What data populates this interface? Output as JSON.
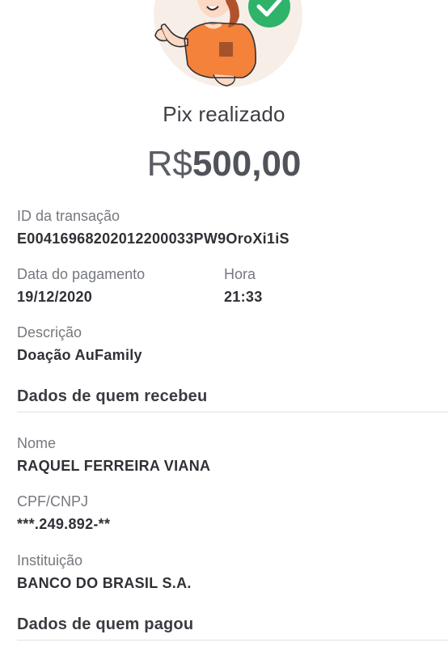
{
  "receipt": {
    "title": "Pix realizado",
    "currency": "R$",
    "amount": "500,00"
  },
  "transaction": {
    "id_label": "ID da transação",
    "id_value": "E00416968202012200033PW9OroXi1iS",
    "date_label": "Data do pagamento",
    "date_value": "19/12/2020",
    "time_label": "Hora",
    "time_value": "21:33",
    "description_label": "Descrição",
    "description_value": "Doação AuFamily"
  },
  "recipient": {
    "section_title": "Dados de quem recebeu",
    "name_label": "Nome",
    "name_value": "RAQUEL FERREIRA VIANA",
    "doc_label": "CPF/CNPJ",
    "doc_value": "***.249.892-**",
    "institution_label": "Instituição",
    "institution_value": "BANCO DO BRASIL S.A."
  },
  "payer": {
    "section_title": "Dados de quem pagou"
  },
  "colors": {
    "shirt": "#f4823a",
    "success": "#2fb36a",
    "background_circle": "#f8ede6"
  },
  "icons": {
    "illustration": "person-thumbs-up-illustration",
    "status": "check-circle-icon"
  }
}
